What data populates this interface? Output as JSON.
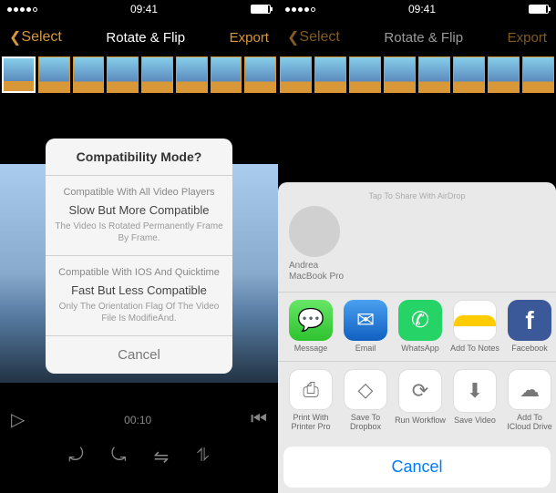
{
  "status": {
    "time": "09:41"
  },
  "nav": {
    "back": "Select",
    "title": "Rotate & Flip",
    "export": "Export"
  },
  "modal": {
    "title": "Compatibility Mode?",
    "sec1_sub": "Compatible With All Video Players",
    "sec1_opt": "Slow But More Compatible",
    "sec1_desc": "The Video Is Rotated Permanently Frame By Frame.",
    "sec2_sub": "Compatible With IOS And Quicktime",
    "sec2_opt": "Fast But Less Compatible",
    "sec2_desc": "Only The Orientation Flag Of The Video File Is ModifieAnd.",
    "cancel": "Cancel"
  },
  "controls": {
    "time": "00:10"
  },
  "share": {
    "hint": "Tap To Share With AirDrop",
    "contact_name": "Andrea",
    "contact_device": "MacBook Pro",
    "row1": [
      {
        "label": "Message",
        "icon": "msg"
      },
      {
        "label": "Email",
        "icon": "mail"
      },
      {
        "label": "WhatsApp",
        "icon": "wa"
      },
      {
        "label": "Add To Notes",
        "icon": "notes"
      },
      {
        "label": "Facebook",
        "icon": "fb"
      }
    ],
    "row2": [
      {
        "label": "Print With Printer Pro",
        "icon": "action",
        "glyph": "⎙"
      },
      {
        "label": "Save To Dropbox",
        "icon": "action",
        "glyph": "◇"
      },
      {
        "label": "Run Workflow",
        "icon": "action",
        "glyph": "⟳"
      },
      {
        "label": "Save Video",
        "icon": "action",
        "glyph": "⬇"
      },
      {
        "label": "Add To ICloud Drive",
        "icon": "action",
        "glyph": "☁"
      }
    ],
    "cancel": "Cancel"
  }
}
